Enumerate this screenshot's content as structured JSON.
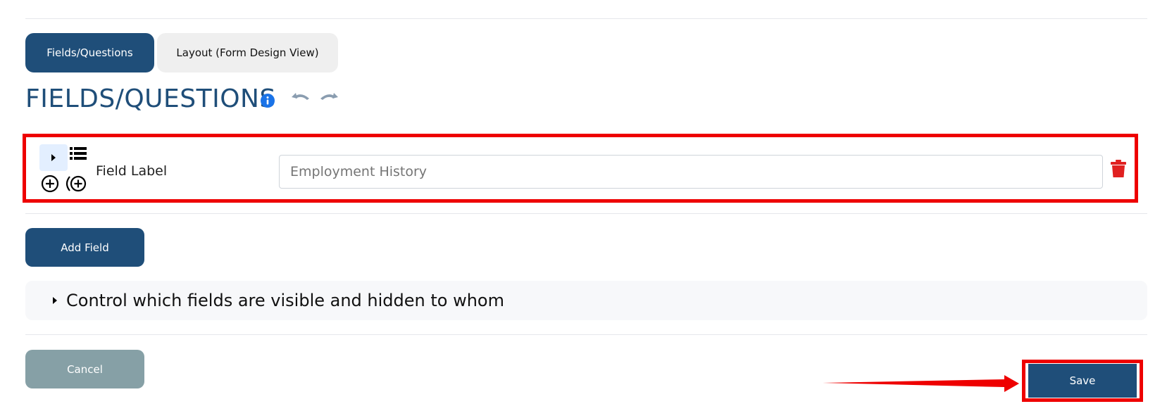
{
  "tabs": [
    {
      "label": "Fields/Questions",
      "active": true
    },
    {
      "label": "Layout (Form Design View)",
      "active": false
    }
  ],
  "section": {
    "title": "FIELDS/QUESTIONS"
  },
  "field": {
    "label": "Field Label",
    "value": "",
    "placeholder": "Employment History"
  },
  "buttons": {
    "add_field": "Add Field",
    "cancel": "Cancel",
    "save": "Save"
  },
  "visibility": {
    "label": "Control which fields are visible and hidden to whom"
  },
  "icons": {
    "info": "info-icon",
    "undo": "undo-icon",
    "redo": "redo-icon",
    "expand": "caret-right-icon",
    "list": "list-icon",
    "add": "plus-circle-icon",
    "add_group": "plus-circle-group-icon",
    "delete": "trash-icon"
  },
  "colors": {
    "primary": "#1f4e79",
    "danger": "#ee0000",
    "muted": "#86a0a6",
    "info": "#1a73e8"
  }
}
